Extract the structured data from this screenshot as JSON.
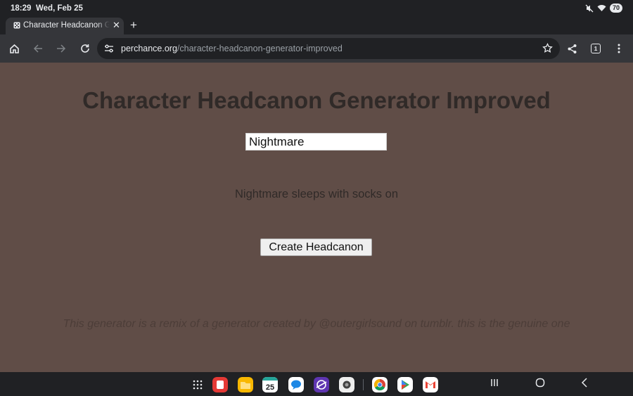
{
  "status": {
    "time": "18:29",
    "date": "Wed, Feb 25",
    "battery": "70"
  },
  "tab": {
    "title": "Character Headcanon Generator Improved"
  },
  "omnibox": {
    "host": "perchance.org",
    "path": "/character-headcanon-generator-improved"
  },
  "toolbar": {
    "tab_count": "1"
  },
  "page": {
    "heading": "Character Headcanon Generator Improved",
    "name_value": "Nightmare",
    "result": "Nightmare sleeps with socks on",
    "button_label": "Create Headcanon",
    "footer_note": "This generator is a remix of a generator created by @outergirlsound on tumblr. this is the genuine one"
  },
  "dock": {
    "calendar_day": "25",
    "apps": [
      "app-drawer-icon",
      "red-app-icon",
      "files-icon",
      "calendar-icon",
      "messages-icon",
      "internet-icon",
      "camera-icon",
      "chrome-icon",
      "play-store-icon",
      "gmail-icon"
    ]
  },
  "colors": {
    "page_bg": "#604d47",
    "heading": "#302a28",
    "chrome_dark": "#202124",
    "chrome_toolbar": "#35363a"
  }
}
